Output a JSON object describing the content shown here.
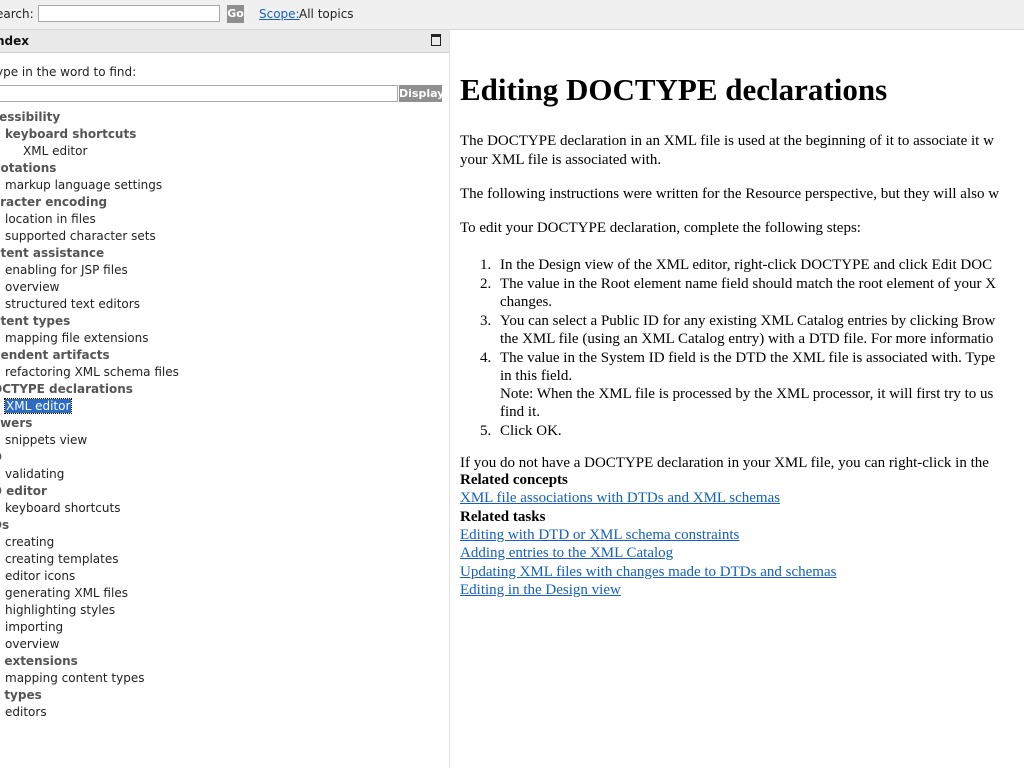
{
  "topbar": {
    "search_label": "earch:",
    "search_value": "",
    "go_label": "Go",
    "scope_link": "Scope:",
    "scope_value": "All topics"
  },
  "index_pane": {
    "title": "ndex",
    "find_label": "ype in the word to find:",
    "find_value": "",
    "display_label": "Display",
    "items": [
      {
        "label": "cessibility",
        "level": "lvl0"
      },
      {
        "label": "keyboard shortcuts",
        "level": "lvl1b"
      },
      {
        "label": "XML editor",
        "level": "lvl2"
      },
      {
        "label": "notations",
        "level": "lvl0"
      },
      {
        "label": "markup language settings",
        "level": "lvl1"
      },
      {
        "label": "aracter encoding",
        "level": "lvl0"
      },
      {
        "label": "location in files",
        "level": "lvl1"
      },
      {
        "label": "supported character sets",
        "level": "lvl1"
      },
      {
        "label": "ntent assistance",
        "level": "lvl0"
      },
      {
        "label": "enabling for JSP files",
        "level": "lvl1"
      },
      {
        "label": "overview",
        "level": "lvl1"
      },
      {
        "label": "structured text editors",
        "level": "lvl1"
      },
      {
        "label": "ntent types",
        "level": "lvl0"
      },
      {
        "label": "mapping file extensions",
        "level": "lvl1"
      },
      {
        "label": "pendent artifacts",
        "level": "lvl0"
      },
      {
        "label": "refactoring XML schema files",
        "level": "lvl1"
      },
      {
        "label": "OCTYPE declarations",
        "level": "lvl0"
      },
      {
        "label": "XML editor",
        "level": "lvl1",
        "selected": true
      },
      {
        "label": "awers",
        "level": "lvl0"
      },
      {
        "label": "snippets view",
        "level": "lvl1"
      },
      {
        "label": "D",
        "level": "lvl0"
      },
      {
        "label": "validating",
        "level": "lvl1"
      },
      {
        "label": "D editor",
        "level": "lvl0"
      },
      {
        "label": "keyboard shortcuts",
        "level": "lvl1"
      },
      {
        "label": "Ds",
        "level": "lvl0"
      },
      {
        "label": "creating",
        "level": "lvl1"
      },
      {
        "label": "creating templates",
        "level": "lvl1"
      },
      {
        "label": "editor icons",
        "level": "lvl1"
      },
      {
        "label": "generating XML files",
        "level": "lvl1"
      },
      {
        "label": "highlighting styles",
        "level": "lvl1"
      },
      {
        "label": "importing",
        "level": "lvl1"
      },
      {
        "label": "overview",
        "level": "lvl1"
      },
      {
        "label": "e extensions",
        "level": "lvl0"
      },
      {
        "label": "mapping content types",
        "level": "lvl1"
      },
      {
        "label": "e types",
        "level": "lvl0"
      },
      {
        "label": "editors",
        "level": "lvl1"
      }
    ]
  },
  "article": {
    "title": "Editing DOCTYPE declarations",
    "intro_line1": "The DOCTYPE declaration in an XML file is used at the beginning of it to associate it w",
    "intro_line2": "your XML file is associated with.",
    "para2": "The following instructions were written for the Resource perspective, but they will also w",
    "para3": "To edit your DOCTYPE declaration, complete the following steps:",
    "steps": [
      {
        "num": "1.",
        "lines": [
          "In the Design view of the XML editor, right-click DOCTYPE and click Edit DOC"
        ]
      },
      {
        "num": "2.",
        "lines": [
          "The value in the Root element name field should match the root element of your X",
          "changes."
        ]
      },
      {
        "num": "3.",
        "lines": [
          "You can select a Public ID for any existing XML Catalog entries by clicking Brow",
          "the XML file (using an XML Catalog entry) with a DTD file. For more informatio"
        ]
      },
      {
        "num": "4.",
        "lines": [
          "The value in the System ID field is the DTD the XML file is associated with. Type",
          "in this field.",
          "Note: When the XML file is processed by the XML processor, it will first try to us",
          "find it."
        ]
      },
      {
        "num": "5.",
        "lines": [
          "Click OK."
        ]
      }
    ],
    "para4": "If you do not have a DOCTYPE declaration in your XML file, you can right-click in the",
    "related_concepts_heading": "Related concepts",
    "related_concepts": [
      "XML file associations with DTDs and XML schemas"
    ],
    "related_tasks_heading": "Related tasks",
    "related_tasks": [
      "Editing with DTD or XML schema constraints",
      "Adding entries to the XML Catalog",
      "Updating XML files with changes made to DTDs and schemas",
      "Editing in the Design view"
    ]
  },
  "colors": {
    "link": "#1560bd",
    "selection": "#2a6cc6",
    "button": "#8f8f8f"
  }
}
